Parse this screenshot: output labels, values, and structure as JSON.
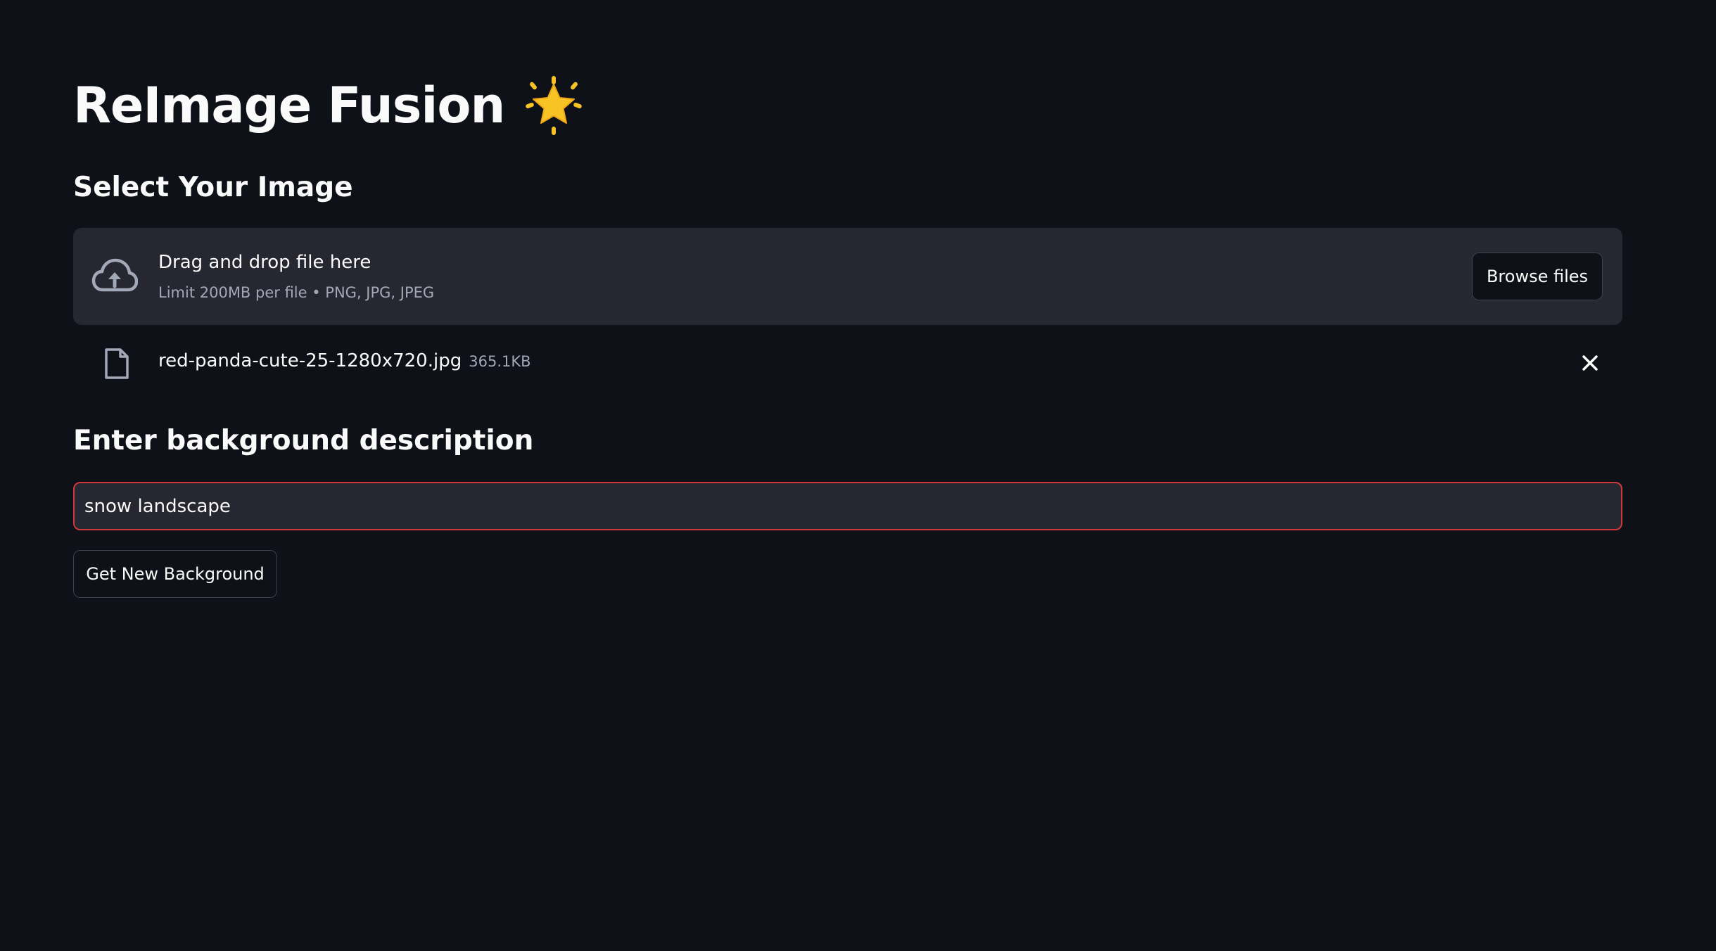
{
  "app": {
    "title": "ReImage Fusion",
    "title_icon": "glowing-star-icon"
  },
  "uploader": {
    "heading": "Select Your Image",
    "drop_label": "Drag and drop file here",
    "limit_text": "Limit 200MB per file • PNG, JPG, JPEG",
    "browse_label": "Browse files",
    "upload_icon": "cloud-upload-icon",
    "uploaded_file": {
      "name": "red-panda-cute-25-1280x720.jpg",
      "size": "365.1KB",
      "icon": "file-icon",
      "remove_icon": "close-icon"
    }
  },
  "background": {
    "heading": "Enter background description",
    "input_value": "snow landscape",
    "submit_label": "Get New Background"
  },
  "colors": {
    "page_background": "#0e1117",
    "panel_background": "#262730",
    "input_focus_border": "#d0383d",
    "star_yellow": "#f7c325"
  }
}
